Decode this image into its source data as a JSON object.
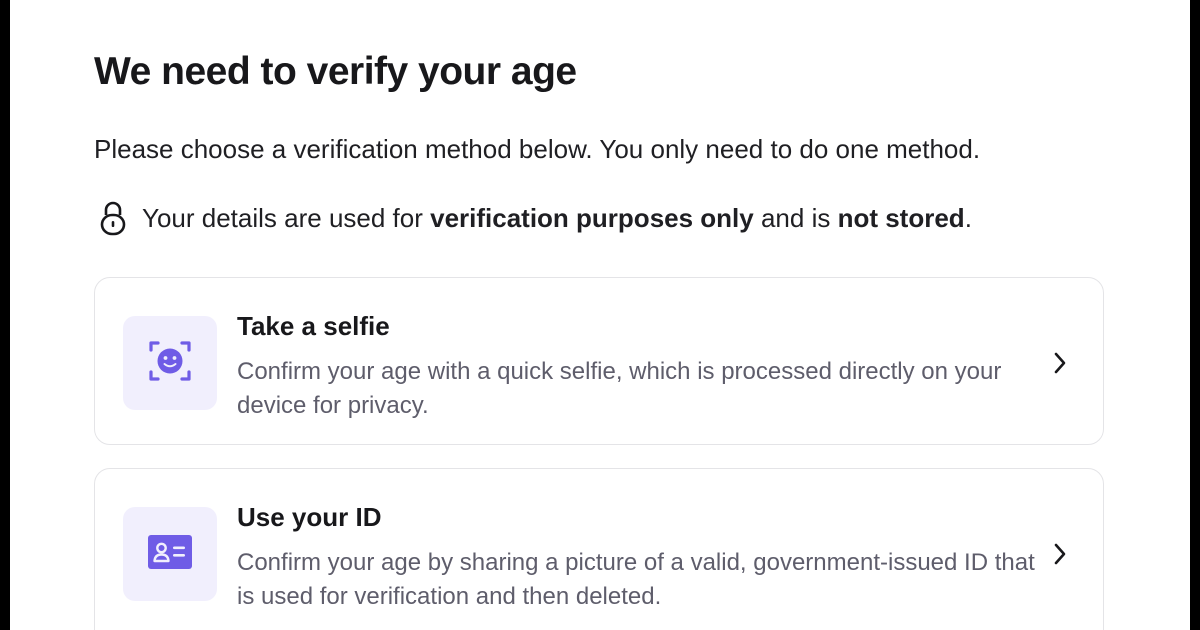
{
  "header": {
    "title": "We need to verify your age",
    "subtitle": "Please choose a verification method below. You only need to do one method."
  },
  "privacy": {
    "icon": "lock-icon",
    "text_before": "Your details are used for ",
    "bold_1": "verification purposes only",
    "text_middle": " and is ",
    "bold_2": "not stored",
    "text_after": "."
  },
  "methods": [
    {
      "icon": "face-scan-icon",
      "title": "Take a selfie",
      "description": "Confirm your age with a quick selfie, which is processed directly on your device for privacy."
    },
    {
      "icon": "id-card-icon",
      "title": "Use your ID",
      "description": "Confirm your age by sharing a picture of a valid, government-issued ID that is used for verification and then deleted."
    }
  ],
  "colors": {
    "accent": "#6f5ce6",
    "icon_bg": "#f1effd",
    "card_border": "#e4e4e7",
    "muted_text": "#5e5d6b"
  }
}
